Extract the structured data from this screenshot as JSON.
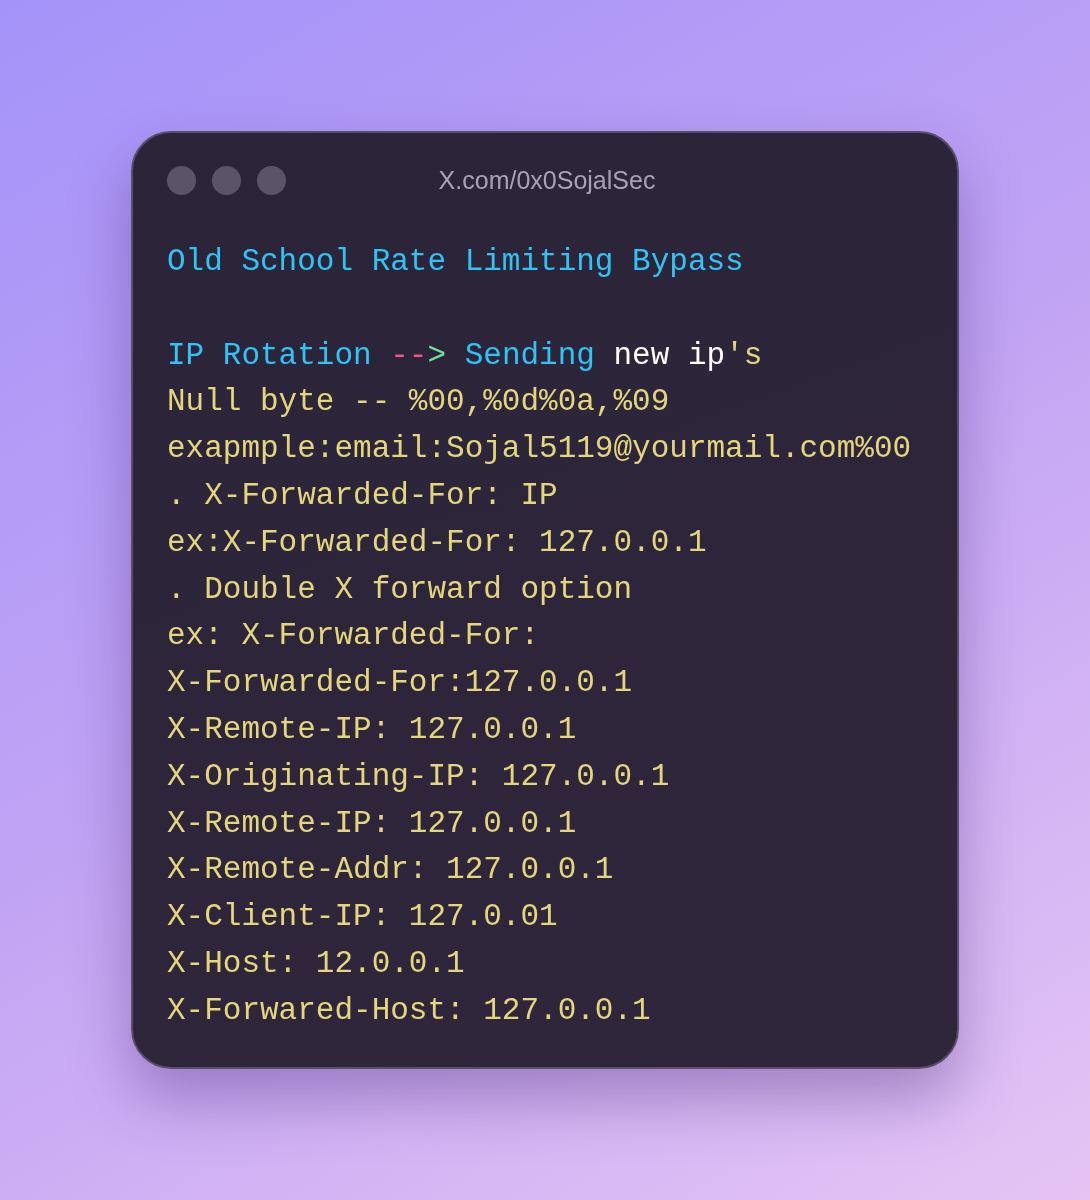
{
  "window": {
    "title": "X.com/0x0SojalSec"
  },
  "heading": "Old School Rate Limiting Bypass",
  "lines": [
    {
      "tokens": [
        {
          "kind": "keyword",
          "text": "IP Rotation "
        },
        {
          "kind": "operator",
          "text": "--"
        },
        {
          "kind": "arrow",
          "text": ">"
        },
        {
          "kind": "keyword",
          "text": " Sending "
        },
        {
          "kind": "plain",
          "text": "new ip"
        },
        {
          "kind": "string",
          "text": "'s"
        }
      ]
    },
    {
      "tokens": [
        {
          "kind": "string",
          "text": "Null byte -- %00,%0d%0a,%09"
        }
      ]
    },
    {
      "tokens": [
        {
          "kind": "string",
          "text": "exapmple:email:Sojal5119@yourmail.com%00"
        }
      ]
    },
    {
      "tokens": [
        {
          "kind": "string",
          "text": ". X-Forwarded-For: IP"
        }
      ]
    },
    {
      "tokens": [
        {
          "kind": "string",
          "text": "ex:X-Forwarded-For: 127.0.0.1"
        }
      ]
    },
    {
      "tokens": [
        {
          "kind": "string",
          "text": ". Double X forward option"
        }
      ]
    },
    {
      "tokens": [
        {
          "kind": "string",
          "text": "ex: X-Forwarded-For:"
        }
      ]
    },
    {
      "tokens": [
        {
          "kind": "string",
          "text": "X-Forwarded-For:127.0.0.1"
        }
      ]
    },
    {
      "tokens": [
        {
          "kind": "string",
          "text": "X-Remote-IP: 127.0.0.1"
        }
      ]
    },
    {
      "tokens": [
        {
          "kind": "string",
          "text": "X-Originating-IP: 127.0.0.1"
        }
      ]
    },
    {
      "tokens": [
        {
          "kind": "string",
          "text": "X-Remote-IP: 127.0.0.1"
        }
      ]
    },
    {
      "tokens": [
        {
          "kind": "string",
          "text": "X-Remote-Addr: 127.0.0.1"
        }
      ]
    },
    {
      "tokens": [
        {
          "kind": "string",
          "text": "X-Client-IP: 127.0.01"
        }
      ]
    },
    {
      "tokens": [
        {
          "kind": "string",
          "text": "X-Host: 12.0.0.1"
        }
      ]
    },
    {
      "tokens": [
        {
          "kind": "string",
          "text": "X-Forwared-Host: 127.0.0.1"
        }
      ]
    }
  ]
}
